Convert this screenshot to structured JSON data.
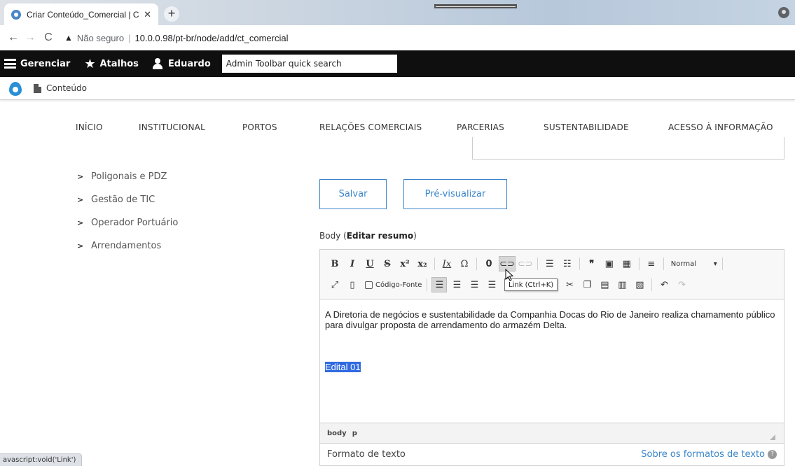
{
  "browser": {
    "tab_title": "Criar Conteúdo_Comercial | CDRJ",
    "tab_close": "✕",
    "new_tab": "+",
    "security_warning": "Não seguro",
    "url": "10.0.0.98/pt-br/node/add/ct_comercial"
  },
  "admin_toolbar": {
    "manage": "Gerenciar",
    "shortcuts": "Atalhos",
    "user": "Eduardo",
    "quick_search_placeholder": "Admin Toolbar quick search"
  },
  "tray": {
    "content": "Conteúdo"
  },
  "main_nav": {
    "items": [
      "INÍCIO",
      "INSTITUCIONAL",
      "PORTOS",
      "RELAÇÕES COMERCIAIS",
      "PARCERIAS",
      "SUSTENTABILIDADE",
      "ACESSO À INFORMAÇÃO"
    ]
  },
  "sidebar": {
    "items": [
      "Poligonais e PDZ",
      "Gestão de TIC",
      "Operador Portuário",
      "Arrendamentos"
    ]
  },
  "actions": {
    "save": "Salvar",
    "preview": "Pré-visualizar"
  },
  "body_field": {
    "label": "Body (",
    "summary_link": "Editar resumo",
    "label_end": ")"
  },
  "editor": {
    "format_select": "Normal",
    "source_label": "Código-Fonte",
    "tooltip": "Link (Ctrl+K)",
    "paragraph": "A Diretoria de negócios e sustentabilidade da Companhia Docas do Rio de Janeiro realiza chamamento público para divulgar proposta de arrendamento do armazém Delta.",
    "selected_text": "Edital 01",
    "path": [
      "body",
      "p"
    ]
  },
  "text_format": {
    "label": "Formato de texto",
    "about_link": "Sobre os formatos de texto"
  },
  "status_bar": "avascript:void('Link')"
}
